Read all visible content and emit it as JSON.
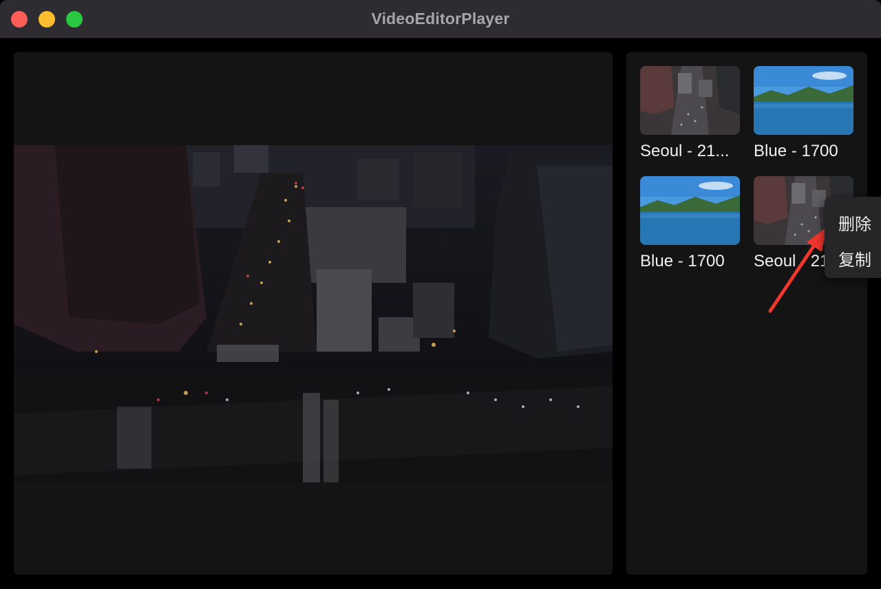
{
  "window": {
    "title": "VideoEditorPlayer"
  },
  "player": {
    "frame_description_icon": "video-frame-city-night"
  },
  "library": {
    "clips": [
      {
        "label": "Seoul - 21...",
        "thumbnail": "city-thumbnail"
      },
      {
        "label": "Blue - 1700",
        "thumbnail": "lake-thumbnail"
      },
      {
        "label": "Blue - 1700",
        "thumbnail": "lake-thumbnail"
      },
      {
        "label": "Seoul - 21...",
        "thumbnail": "city-thumbnail"
      }
    ]
  },
  "context_menu": {
    "items": [
      {
        "label": "删除"
      },
      {
        "label": "复制"
      }
    ]
  },
  "colors": {
    "close": "#fe5f57",
    "minimize": "#febc2e",
    "zoom": "#28c840",
    "annotation_arrow": "#f0362d"
  }
}
